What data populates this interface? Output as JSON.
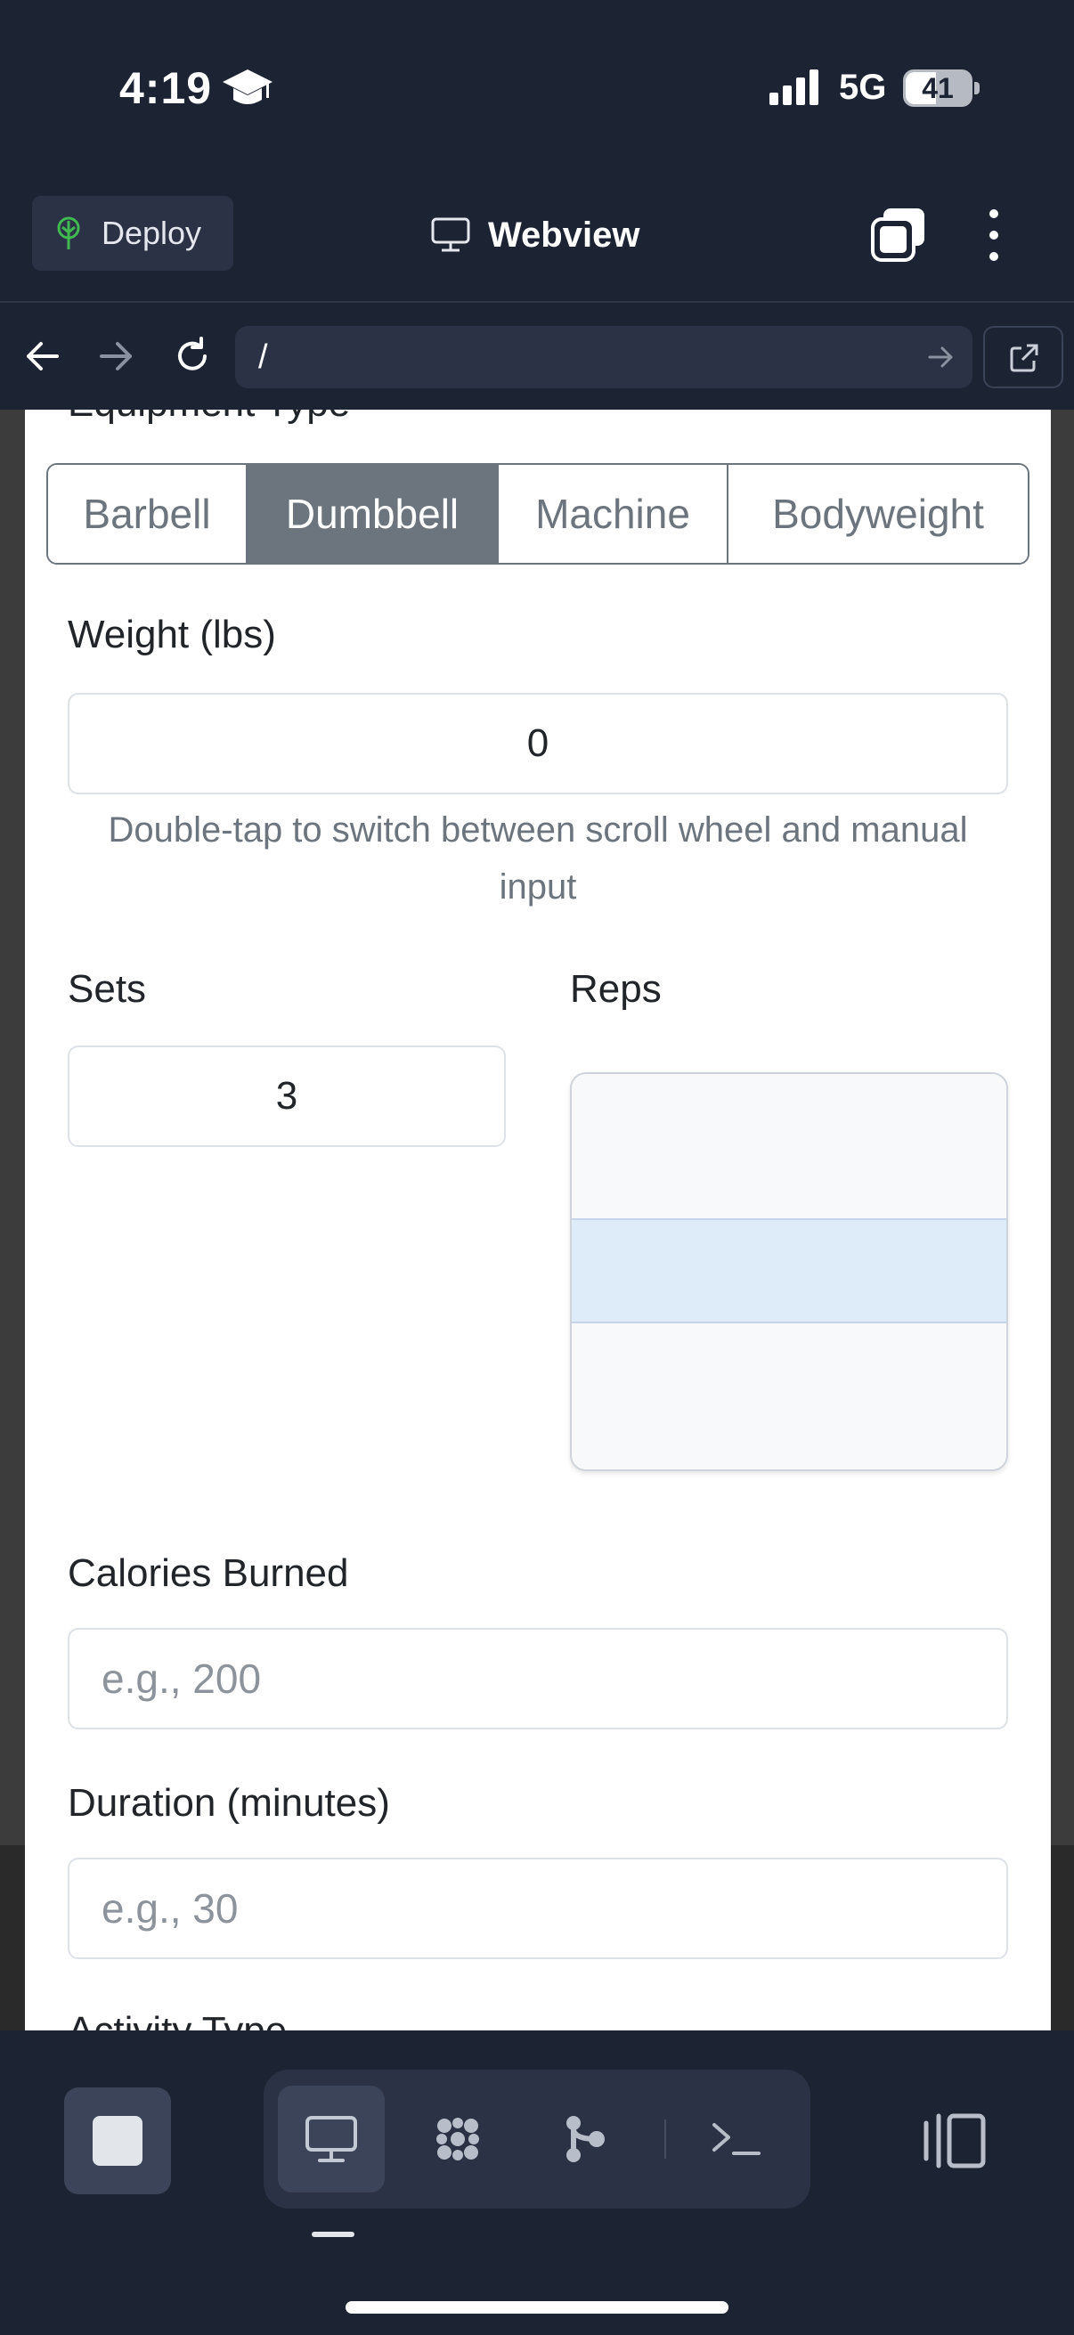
{
  "status_bar": {
    "time": "4:19",
    "network": "5G",
    "battery": "41",
    "icons": [
      "graduation-cap-icon",
      "signal-icon",
      "battery-icon"
    ]
  },
  "header": {
    "deploy_label": "Deploy",
    "title": "Webview",
    "icons": [
      "deploy-icon",
      "monitor-icon",
      "tabs-icon",
      "kebab-menu-icon"
    ]
  },
  "url_bar": {
    "url": "/",
    "icons": [
      "back-arrow-icon",
      "forward-arrow-icon",
      "reload-icon",
      "go-arrow-icon",
      "external-link-icon"
    ]
  },
  "form": {
    "equipment_label": "Equipment Type",
    "equipment_options": [
      "Barbell",
      "Dumbbell",
      "Machine",
      "Bodyweight"
    ],
    "equipment_selected": "Dumbbell",
    "weight_label": "Weight (lbs)",
    "weight_value": "0",
    "weight_hint": "Double-tap to switch between scroll wheel and manual input",
    "sets_label": "Sets",
    "sets_value": "3",
    "reps_label": "Reps",
    "calories_label": "Calories Burned",
    "calories_placeholder": "e.g., 200",
    "duration_label": "Duration (minutes)",
    "duration_placeholder": "e.g., 30",
    "activity_label": "Activity Type"
  },
  "toolbar": {
    "items": [
      "stop-icon",
      "monitor-icon",
      "cluster-icon",
      "branch-icon",
      "terminal-icon",
      "panel-toggle-icon"
    ],
    "active": "monitor-icon"
  },
  "colors": {
    "background": "#1c2333",
    "surface": "#2b3245",
    "segment_active": "#6c757d",
    "wheel_highlight": "#deebf8"
  }
}
